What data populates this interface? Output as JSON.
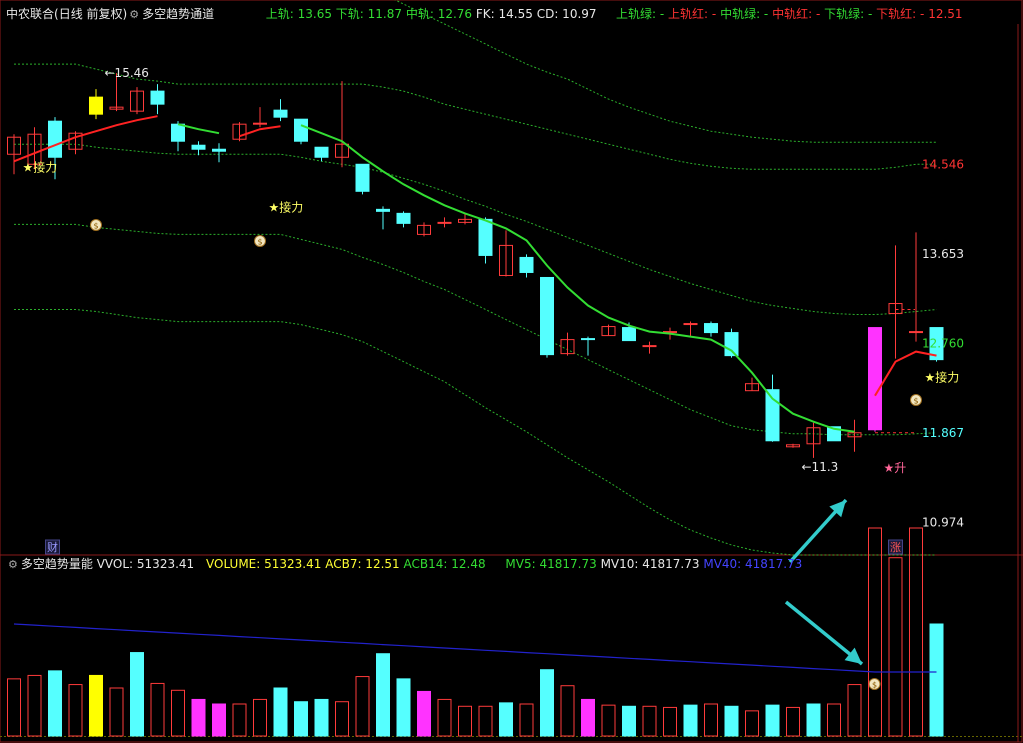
{
  "main_header": {
    "stock": "中农联合",
    "period": "(日线 前复权)",
    "indicator": "多空趋势通道",
    "upper_label": "上轨: 13.65",
    "lower_label": "下轨: 11.87",
    "middle_label": "中轨: 12.76",
    "fk_label": "FK: 14.55",
    "cd_label": "CD: 10.97",
    "right_items": [
      "上轨绿: -",
      "上轨红: -",
      "中轨绿: -",
      "中轨红: -",
      "下轨绿: -",
      "下轨红: -",
      "12.51"
    ]
  },
  "vol_header": {
    "indicator": "多空趋势量能",
    "vvol": "VVOL: 51323.41",
    "volume": "VOLUME: 51323.41",
    "acb7": "ACB7: 12.51",
    "acb14": "ACB14: 12.48",
    "mv5": "MV5: 41817.73",
    "mv10": "MV10: 41817.73",
    "mv40": "MV40: 41817.73"
  },
  "colors": {
    "up": "#ff3b3b",
    "down": "#55ffff",
    "ma_green": "#33dd33",
    "ma_red": "#ff2222",
    "band": "#33cc33",
    "magenta": "#ff33ff",
    "yellow": "#ffff00",
    "mv40_blue": "#2222cc"
  },
  "chart_data": {
    "type": "candlestick",
    "price_range": [
      10.65,
      15.95
    ],
    "y_tick_labels": [
      {
        "value": 14.546,
        "label": "14.546",
        "color": "#ff3333"
      },
      {
        "value": 13.653,
        "label": "13.653",
        "color": "#e8e8e8"
      },
      {
        "value": 12.76,
        "label": "12.760",
        "color": "#33dd33"
      },
      {
        "value": 11.867,
        "label": "11.867",
        "color": "#55ffff"
      },
      {
        "value": 10.974,
        "label": "10.974",
        "color": "#e8e8e8"
      }
    ],
    "candles": [
      {
        "o": 14.65,
        "h": 14.85,
        "l": 14.45,
        "c": 14.82
      },
      {
        "o": 14.55,
        "h": 14.92,
        "l": 14.5,
        "c": 14.85
      },
      {
        "o": 14.98,
        "h": 15.02,
        "l": 14.4,
        "c": 14.62
      },
      {
        "o": 14.7,
        "h": 14.88,
        "l": 14.65,
        "c": 14.86
      },
      {
        "o": 15.05,
        "h": 15.3,
        "l": 15.0,
        "c": 15.22
      },
      {
        "o": 15.1,
        "h": 15.46,
        "l": 15.08,
        "c": 15.12
      },
      {
        "o": 15.08,
        "h": 15.32,
        "l": 15.05,
        "c": 15.28
      },
      {
        "o": 15.28,
        "h": 15.35,
        "l": 15.05,
        "c": 15.15
      },
      {
        "o": 14.95,
        "h": 14.98,
        "l": 14.68,
        "c": 14.78
      },
      {
        "o": 14.74,
        "h": 14.78,
        "l": 14.64,
        "c": 14.7
      },
      {
        "o": 14.7,
        "h": 14.76,
        "l": 14.57,
        "c": 14.68
      },
      {
        "o": 14.8,
        "h": 14.97,
        "l": 14.78,
        "c": 14.95
      },
      {
        "o": 14.95,
        "h": 15.12,
        "l": 14.92,
        "c": 14.96
      },
      {
        "o": 15.09,
        "h": 15.2,
        "l": 14.98,
        "c": 15.02
      },
      {
        "o": 15.0,
        "h": 15.0,
        "l": 14.75,
        "c": 14.78
      },
      {
        "o": 14.72,
        "h": 14.72,
        "l": 14.58,
        "c": 14.62
      },
      {
        "o": 14.62,
        "h": 15.38,
        "l": 14.52,
        "c": 14.75
      },
      {
        "o": 14.55,
        "h": 14.55,
        "l": 14.25,
        "c": 14.28
      },
      {
        "o": 14.1,
        "h": 14.13,
        "l": 13.9,
        "c": 14.08
      },
      {
        "o": 14.06,
        "h": 14.08,
        "l": 13.92,
        "c": 13.96
      },
      {
        "o": 13.85,
        "h": 13.97,
        "l": 13.83,
        "c": 13.94
      },
      {
        "o": 13.97,
        "h": 14.02,
        "l": 13.92,
        "c": 13.97
      },
      {
        "o": 13.97,
        "h": 14.06,
        "l": 13.95,
        "c": 14.0
      },
      {
        "o": 14.0,
        "h": 14.02,
        "l": 13.56,
        "c": 13.64
      },
      {
        "o": 13.44,
        "h": 13.89,
        "l": 13.43,
        "c": 13.74
      },
      {
        "o": 13.62,
        "h": 13.65,
        "l": 13.42,
        "c": 13.47
      },
      {
        "o": 13.42,
        "h": 13.42,
        "l": 12.62,
        "c": 12.65
      },
      {
        "o": 12.66,
        "h": 12.87,
        "l": 12.64,
        "c": 12.8
      },
      {
        "o": 12.81,
        "h": 12.83,
        "l": 12.64,
        "c": 12.8
      },
      {
        "o": 12.84,
        "h": 12.95,
        "l": 12.84,
        "c": 12.93
      },
      {
        "o": 12.92,
        "h": 12.97,
        "l": 12.79,
        "c": 12.79
      },
      {
        "o": 12.74,
        "h": 12.78,
        "l": 12.66,
        "c": 12.74
      },
      {
        "o": 12.88,
        "h": 12.92,
        "l": 12.8,
        "c": 12.88
      },
      {
        "o": 12.96,
        "h": 12.98,
        "l": 12.83,
        "c": 12.96
      },
      {
        "o": 12.96,
        "h": 12.98,
        "l": 12.83,
        "c": 12.87
      },
      {
        "o": 12.87,
        "h": 12.91,
        "l": 12.62,
        "c": 12.64
      },
      {
        "o": 12.29,
        "h": 12.42,
        "l": 12.29,
        "c": 12.36
      },
      {
        "o": 12.3,
        "h": 12.45,
        "l": 11.78,
        "c": 11.79
      },
      {
        "o": 11.73,
        "h": 11.76,
        "l": 11.72,
        "c": 11.75
      },
      {
        "o": 11.76,
        "h": 11.97,
        "l": 11.62,
        "c": 11.92
      },
      {
        "o": 11.93,
        "h": 11.93,
        "l": 11.79,
        "c": 11.79
      },
      {
        "o": 11.83,
        "h": 12.0,
        "l": 11.68,
        "c": 11.87
      },
      {
        "o": 11.9,
        "h": 12.92,
        "l": 11.88,
        "c": 12.92
      },
      {
        "o": 13.06,
        "h": 13.74,
        "l": 12.61,
        "c": 13.16
      },
      {
        "o": 12.88,
        "h": 13.87,
        "l": 12.78,
        "c": 12.88
      },
      {
        "o": 12.92,
        "h": 12.92,
        "l": 12.58,
        "c": 12.6
      }
    ],
    "special_candles": {
      "yellow": [
        4
      ],
      "magenta": [
        42
      ]
    },
    "upper_band": [
      15.55,
      15.55,
      15.55,
      15.55,
      15.5,
      15.45,
      15.4,
      15.38,
      15.35,
      15.35,
      15.35,
      15.35,
      15.35,
      15.35,
      15.35,
      15.35,
      15.35,
      15.35,
      15.32,
      15.28,
      15.22,
      15.15,
      15.1,
      15.05,
      15.0,
      14.95,
      14.9,
      14.85,
      14.8,
      14.75,
      14.7,
      14.65,
      14.6,
      14.56,
      14.53,
      14.51,
      14.5,
      14.5,
      14.5,
      14.5,
      14.5,
      14.5,
      14.5,
      14.52,
      14.55,
      14.55
    ],
    "fk_band": [
      16.45,
      16.45,
      16.45,
      16.45,
      16.42,
      16.4,
      16.38,
      16.35,
      16.35,
      16.35,
      16.35,
      16.35,
      16.35,
      16.35,
      16.35,
      16.35,
      16.35,
      16.35,
      16.25,
      16.15,
      16.05,
      15.95,
      15.85,
      15.75,
      15.65,
      15.55,
      15.47,
      15.4,
      15.3,
      15.2,
      15.12,
      15.05,
      14.98,
      14.93,
      14.88,
      14.85,
      14.82,
      14.8,
      14.78,
      14.77,
      14.77,
      14.77,
      14.77,
      14.77,
      14.77,
      14.77
    ],
    "middle_band": [
      14.75,
      14.75,
      14.75,
      14.75,
      14.72,
      14.7,
      14.68,
      14.66,
      14.65,
      14.65,
      14.65,
      14.65,
      14.65,
      14.65,
      14.62,
      14.58,
      14.55,
      14.52,
      14.47,
      14.41,
      14.35,
      14.28,
      14.2,
      14.13,
      14.05,
      13.98,
      13.9,
      13.82,
      13.74,
      13.66,
      13.58,
      13.5,
      13.43,
      13.36,
      13.3,
      13.24,
      13.18,
      13.14,
      13.11,
      13.08,
      13.06,
      13.05,
      13.05,
      13.06,
      13.08,
      13.1
    ],
    "lower_band": [
      13.95,
      13.95,
      13.95,
      13.95,
      13.92,
      13.9,
      13.88,
      13.86,
      13.85,
      13.85,
      13.85,
      13.85,
      13.85,
      13.85,
      13.8,
      13.75,
      13.7,
      13.62,
      13.55,
      13.47,
      13.38,
      13.3,
      13.2,
      13.1,
      13.0,
      12.9,
      12.8,
      12.7,
      12.6,
      12.5,
      12.4,
      12.3,
      12.2,
      12.1,
      12.02,
      11.94,
      11.9,
      11.88,
      11.86,
      11.86,
      11.85,
      11.85,
      11.85,
      11.85,
      11.86,
      11.87
    ],
    "cd_band": [
      13.1,
      13.1,
      13.1,
      13.1,
      13.08,
      13.05,
      13.02,
      13.0,
      12.98,
      12.98,
      12.98,
      12.98,
      12.98,
      12.98,
      12.95,
      12.9,
      12.85,
      12.78,
      12.68,
      12.58,
      12.48,
      12.38,
      12.25,
      12.12,
      12.0,
      11.88,
      11.75,
      11.62,
      11.5,
      11.38,
      11.25,
      11.12,
      11.0,
      10.9,
      10.82,
      10.75,
      10.7,
      10.67,
      10.65,
      10.65,
      10.65,
      10.65,
      10.65,
      10.65,
      10.65,
      10.65
    ],
    "ma_segments": [
      {
        "color": "red",
        "points": [
          [
            0,
            14.58
          ],
          [
            1,
            14.66
          ],
          [
            2,
            14.74
          ],
          [
            3,
            14.82
          ],
          [
            4,
            14.88
          ],
          [
            5,
            14.94
          ],
          [
            6,
            14.99
          ],
          [
            7,
            15.03
          ]
        ]
      },
      {
        "color": "green",
        "points": [
          [
            8,
            14.95
          ],
          [
            9,
            14.9
          ],
          [
            10,
            14.86
          ]
        ]
      },
      {
        "color": "red",
        "points": [
          [
            11,
            14.83
          ],
          [
            12,
            14.9
          ],
          [
            13,
            14.93
          ]
        ]
      },
      {
        "color": "green",
        "points": [
          [
            14,
            14.94
          ],
          [
            15,
            14.86
          ],
          [
            16,
            14.78
          ],
          [
            17,
            14.62
          ],
          [
            18,
            14.48
          ],
          [
            19,
            14.35
          ],
          [
            20,
            14.24
          ],
          [
            21,
            14.14
          ],
          [
            22,
            14.06
          ],
          [
            23,
            13.99
          ],
          [
            24,
            13.91
          ],
          [
            25,
            13.79
          ],
          [
            26,
            13.54
          ],
          [
            27,
            13.32
          ],
          [
            28,
            13.14
          ],
          [
            29,
            13.02
          ],
          [
            30,
            12.94
          ],
          [
            31,
            12.88
          ],
          [
            32,
            12.86
          ],
          [
            33,
            12.83
          ],
          [
            34,
            12.8
          ],
          [
            35,
            12.69
          ],
          [
            36,
            12.47
          ],
          [
            37,
            12.21
          ],
          [
            38,
            12.06
          ],
          [
            39,
            11.98
          ],
          [
            40,
            11.91
          ],
          [
            41,
            11.88
          ]
        ]
      },
      {
        "color": "red",
        "points": [
          [
            42,
            12.24
          ],
          [
            43,
            12.58
          ],
          [
            44,
            12.68
          ],
          [
            45,
            12.64
          ]
        ]
      }
    ],
    "annotations": [
      {
        "text": "★接力",
        "candle": 1,
        "price": 14.52,
        "color": "#ffff66"
      },
      {
        "text": "★接力",
        "candle": 13,
        "price": 14.12,
        "color": "#ffff66"
      },
      {
        "text": "★接力",
        "candle": 45,
        "price": 12.42,
        "color": "#ffff66"
      },
      {
        "text": "★升",
        "candle": 43,
        "price": 11.52,
        "color": "#ff6699"
      },
      {
        "text": "←15.46",
        "candle": 5,
        "price": 15.46,
        "color": "#e8e8e8"
      },
      {
        "text": "←11.3",
        "candle": 39,
        "price": 11.53,
        "color": "#e8e8e8"
      }
    ],
    "badges": [
      {
        "text": "财",
        "candle": 1,
        "pane": "main"
      },
      {
        "text": "涨",
        "candle": 43,
        "pane": "main"
      }
    ],
    "volume": {
      "max": 140000,
      "bars": [
        50,
        53,
        57,
        45,
        53,
        42,
        73,
        46,
        40,
        32,
        28,
        28,
        32,
        42,
        30,
        32,
        30,
        52,
        72,
        50,
        39,
        32,
        26,
        26,
        29,
        28,
        58,
        44,
        32,
        27,
        26,
        26,
        25,
        27,
        28,
        26,
        22,
        27,
        25,
        28,
        28,
        45,
        182,
        156,
        182,
        98
      ],
      "up": [
        true,
        true,
        false,
        true,
        false,
        true,
        false,
        true,
        true,
        false,
        false,
        true,
        true,
        false,
        false,
        false,
        true,
        true,
        false,
        false,
        true,
        true,
        true,
        true,
        false,
        true,
        false,
        true,
        true,
        true,
        false,
        true,
        true,
        false,
        true,
        false,
        true,
        false,
        true,
        false,
        true,
        true,
        true,
        true,
        true,
        false
      ],
      "magenta_bars": [
        9,
        10,
        20,
        28
      ],
      "mv40": [
        98,
        97,
        96,
        95,
        94,
        93,
        92,
        91,
        90,
        89,
        88,
        87,
        86,
        85,
        84,
        83,
        82,
        81,
        80,
        79,
        78,
        77,
        76,
        75,
        74,
        73,
        72,
        71,
        70,
        69,
        68,
        67,
        66,
        65,
        64,
        63,
        62,
        61,
        60,
        59,
        58,
        57,
        56,
        56,
        56,
        56
      ]
    }
  }
}
